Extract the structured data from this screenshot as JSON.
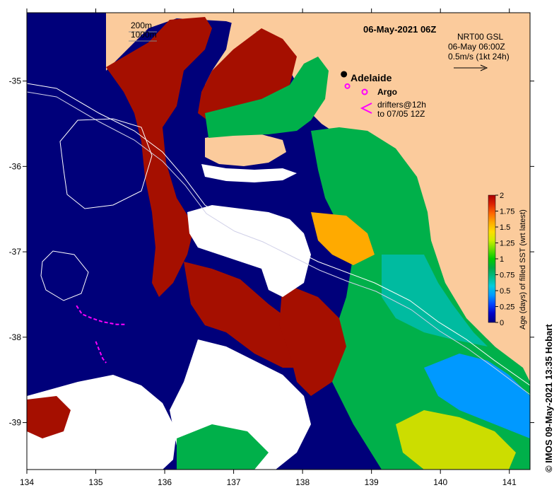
{
  "title": "06-May-2021 06Z",
  "depth_legend": {
    "line1": "200m",
    "line2": "1000m"
  },
  "current_info": {
    "line1": "NRT00 GSL",
    "line2": "06-May 06:00Z",
    "line3": "0.5m/s (1kt 24h)"
  },
  "city": {
    "name": "Adelaide"
  },
  "argo": {
    "label": "Argo"
  },
  "drifters": {
    "line1": "drifters@12h",
    "line2": "to 07/05 12Z"
  },
  "colorbar": {
    "label": "Age (days) of filled SST (wrt latest)",
    "ticks": [
      "2",
      "1.75",
      "1.5",
      "1.25",
      "1",
      "0.75",
      "0.5",
      "0.25",
      "0"
    ],
    "colors": [
      "#00007f",
      "#0000c8",
      "#0044ff",
      "#0099ff",
      "#00ccdd",
      "#00bb88",
      "#00aa44",
      "#00cc00",
      "#66dd00",
      "#ccee00",
      "#ffdd00",
      "#ffaa00",
      "#ff6600",
      "#dd2200",
      "#aa0000"
    ]
  },
  "credit": "© IMOS 09-May-2021 13:35 Hobart",
  "colors": {
    "land": "#fbcb9c",
    "no_data": "#ffffff",
    "deep_blue": "#00007a",
    "dark_red": "#a50f00",
    "green": "#00b04a",
    "bright_green": "#00c800"
  },
  "chart_data": {
    "type": "map",
    "x_axis": {
      "ticks": [
        "134",
        "135",
        "136",
        "137",
        "138",
        "139",
        "140",
        "141"
      ],
      "range": [
        134,
        141.3
      ]
    },
    "y_axis": {
      "ticks": [
        "-35",
        "-36",
        "-37",
        "-38",
        "-39"
      ],
      "range": [
        -39.55,
        -34.2
      ]
    },
    "city": {
      "name": "Adelaide",
      "lon": 138.6,
      "lat": -34.92
    },
    "argo_floats": [
      {
        "lon": 138.65,
        "lat": -35.06
      }
    ],
    "drifter_tracks": [
      {
        "points": [
          [
            134.72,
            -37.63
          ],
          [
            134.8,
            -37.73
          ],
          [
            134.95,
            -37.78
          ],
          [
            135.1,
            -37.82
          ],
          [
            135.3,
            -37.85
          ],
          [
            135.45,
            -37.85
          ]
        ]
      },
      {
        "points": [
          [
            135.0,
            -38.05
          ],
          [
            135.05,
            -38.15
          ],
          [
            135.1,
            -38.25
          ],
          [
            135.15,
            -38.3
          ]
        ]
      }
    ]
  }
}
